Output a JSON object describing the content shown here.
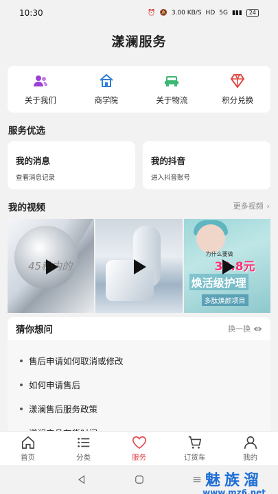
{
  "status_bar": {
    "time": "10:30",
    "speed": "3.00 KB/S",
    "hd": "HD",
    "network": "5G",
    "battery": "24"
  },
  "page": {
    "title": "漾澜服务"
  },
  "quick_actions": [
    {
      "label": "关于我们",
      "icon": "users-icon",
      "color": "#9b3fd6"
    },
    {
      "label": "商学院",
      "icon": "home-icon",
      "color": "#2e7fd8"
    },
    {
      "label": "关于物流",
      "icon": "car-icon",
      "color": "#3cb873"
    },
    {
      "label": "积分兑换",
      "icon": "diamond-icon",
      "color": "#e2473f"
    }
  ],
  "service_section": {
    "title": "服务优选"
  },
  "feature_cards": [
    {
      "title": "我的消息",
      "subtitle": "查看消息记录"
    },
    {
      "title": "我的抖音",
      "subtitle": "进入抖音账号"
    }
  ],
  "video_section": {
    "title": "我的视频",
    "more_label": "更多视频",
    "videos": [
      {
        "overlay_text": "45秒内的"
      },
      {
        "overlay_text": ""
      },
      {
        "caption_top": "为什么要做",
        "price": "39.8元",
        "caption_main": "焕活级护理",
        "caption_sub": "多肽焕颜项目"
      }
    ]
  },
  "faq_section": {
    "title": "猜你想问",
    "refresh_label": "换一换",
    "items": [
      "售后申请如何取消或修改",
      "如何申请售后",
      "漾澜售后服务政策",
      "漾澜产品有货时间"
    ]
  },
  "tab_bar": {
    "active": "服务",
    "active_color": "#e0474c",
    "tabs": [
      {
        "label": "首页",
        "icon": "home-icon"
      },
      {
        "label": "分类",
        "icon": "list-icon"
      },
      {
        "label": "服务",
        "icon": "heart-icon"
      },
      {
        "label": "订货车",
        "icon": "cart-icon"
      },
      {
        "label": "我的",
        "icon": "user-icon"
      }
    ]
  },
  "watermark": {
    "brand": "魅族溜",
    "url": "www.mz6.net"
  }
}
